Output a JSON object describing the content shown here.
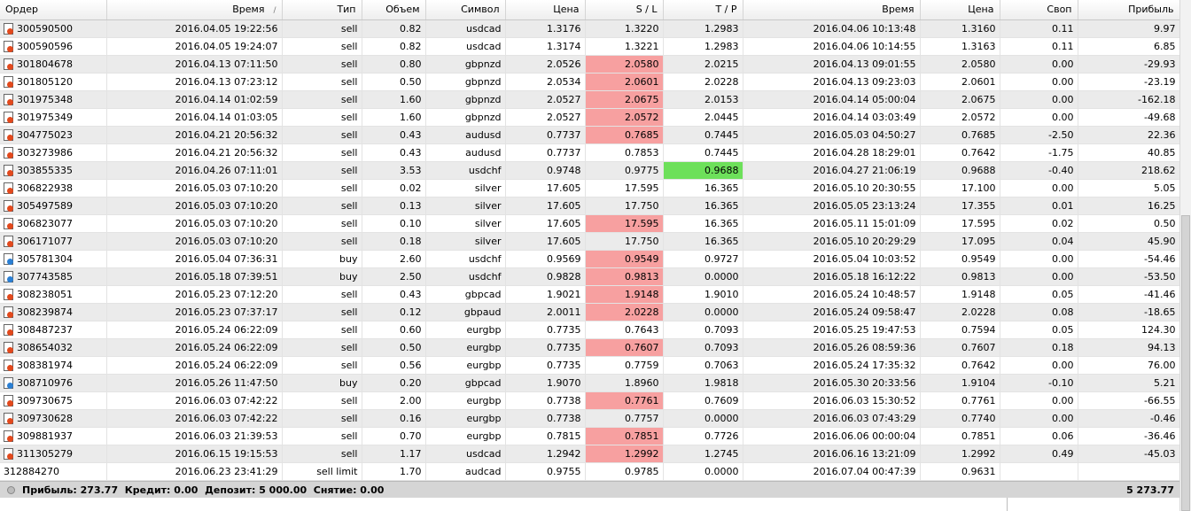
{
  "columns": {
    "order": "Ордер",
    "open_time": "Время",
    "type": "Тип",
    "volume": "Объем",
    "symbol": "Символ",
    "open_price": "Цена",
    "sl": "S / L",
    "tp": "T / P",
    "close_time": "Время",
    "close_price": "Цена",
    "swap": "Своп",
    "profit": "Прибыль"
  },
  "sort_indicator": "/",
  "colors": {
    "sl_hit": "#f7a0a0",
    "tp_hit": "#6de05a",
    "sell_icon": "#e2491d",
    "buy_icon": "#2b7fd3"
  },
  "icons": {
    "sell": "sell-order-icon",
    "buy": "buy-order-icon"
  },
  "rows": [
    {
      "order": "300590500",
      "open_time": "2016.04.05 19:22:56",
      "type": "sell",
      "volume": "0.82",
      "symbol": "usdcad",
      "open_price": "1.3176",
      "sl": "1.3220",
      "tp": "1.2983",
      "close_time": "2016.04.06 10:13:48",
      "close_price": "1.3160",
      "swap": "0.11",
      "profit": "9.97",
      "icon": "sell",
      "hit": ""
    },
    {
      "order": "300590596",
      "open_time": "2016.04.05 19:24:07",
      "type": "sell",
      "volume": "0.82",
      "symbol": "usdcad",
      "open_price": "1.3174",
      "sl": "1.3221",
      "tp": "1.2983",
      "close_time": "2016.04.06 10:14:55",
      "close_price": "1.3163",
      "swap": "0.11",
      "profit": "6.85",
      "icon": "sell",
      "hit": ""
    },
    {
      "order": "301804678",
      "open_time": "2016.04.13 07:11:50",
      "type": "sell",
      "volume": "0.80",
      "symbol": "gbpnzd",
      "open_price": "2.0526",
      "sl": "2.0580",
      "tp": "2.0215",
      "close_time": "2016.04.13 09:01:55",
      "close_price": "2.0580",
      "swap": "0.00",
      "profit": "-29.93",
      "icon": "sell",
      "hit": "sl"
    },
    {
      "order": "301805120",
      "open_time": "2016.04.13 07:23:12",
      "type": "sell",
      "volume": "0.50",
      "symbol": "gbpnzd",
      "open_price": "2.0534",
      "sl": "2.0601",
      "tp": "2.0228",
      "close_time": "2016.04.13 09:23:03",
      "close_price": "2.0601",
      "swap": "0.00",
      "profit": "-23.19",
      "icon": "sell",
      "hit": "sl"
    },
    {
      "order": "301975348",
      "open_time": "2016.04.14 01:02:59",
      "type": "sell",
      "volume": "1.60",
      "symbol": "gbpnzd",
      "open_price": "2.0527",
      "sl": "2.0675",
      "tp": "2.0153",
      "close_time": "2016.04.14 05:00:04",
      "close_price": "2.0675",
      "swap": "0.00",
      "profit": "-162.18",
      "icon": "sell",
      "hit": "sl"
    },
    {
      "order": "301975349",
      "open_time": "2016.04.14 01:03:05",
      "type": "sell",
      "volume": "1.60",
      "symbol": "gbpnzd",
      "open_price": "2.0527",
      "sl": "2.0572",
      "tp": "2.0445",
      "close_time": "2016.04.14 03:03:49",
      "close_price": "2.0572",
      "swap": "0.00",
      "profit": "-49.68",
      "icon": "sell",
      "hit": "sl"
    },
    {
      "order": "304775023",
      "open_time": "2016.04.21 20:56:32",
      "type": "sell",
      "volume": "0.43",
      "symbol": "audusd",
      "open_price": "0.7737",
      "sl": "0.7685",
      "tp": "0.7445",
      "close_time": "2016.05.03 04:50:27",
      "close_price": "0.7685",
      "swap": "-2.50",
      "profit": "22.36",
      "icon": "sell",
      "hit": "sl"
    },
    {
      "order": "303273986",
      "open_time": "2016.04.21 20:56:32",
      "type": "sell",
      "volume": "0.43",
      "symbol": "audusd",
      "open_price": "0.7737",
      "sl": "0.7853",
      "tp": "0.7445",
      "close_time": "2016.04.28 18:29:01",
      "close_price": "0.7642",
      "swap": "-1.75",
      "profit": "40.85",
      "icon": "sell",
      "hit": ""
    },
    {
      "order": "303855335",
      "open_time": "2016.04.26 07:11:01",
      "type": "sell",
      "volume": "3.53",
      "symbol": "usdchf",
      "open_price": "0.9748",
      "sl": "0.9775",
      "tp": "0.9688",
      "close_time": "2016.04.27 21:06:19",
      "close_price": "0.9688",
      "swap": "-0.40",
      "profit": "218.62",
      "icon": "sell",
      "hit": "tp"
    },
    {
      "order": "306822938",
      "open_time": "2016.05.03 07:10:20",
      "type": "sell",
      "volume": "0.02",
      "symbol": "silver",
      "open_price": "17.605",
      "sl": "17.595",
      "tp": "16.365",
      "close_time": "2016.05.10 20:30:55",
      "close_price": "17.100",
      "swap": "0.00",
      "profit": "5.05",
      "icon": "sell",
      "hit": ""
    },
    {
      "order": "305497589",
      "open_time": "2016.05.03 07:10:20",
      "type": "sell",
      "volume": "0.13",
      "symbol": "silver",
      "open_price": "17.605",
      "sl": "17.750",
      "tp": "16.365",
      "close_time": "2016.05.05 23:13:24",
      "close_price": "17.355",
      "swap": "0.01",
      "profit": "16.25",
      "icon": "sell",
      "hit": ""
    },
    {
      "order": "306823077",
      "open_time": "2016.05.03 07:10:20",
      "type": "sell",
      "volume": "0.10",
      "symbol": "silver",
      "open_price": "17.605",
      "sl": "17.595",
      "tp": "16.365",
      "close_time": "2016.05.11 15:01:09",
      "close_price": "17.595",
      "swap": "0.02",
      "profit": "0.50",
      "icon": "sell",
      "hit": "sl"
    },
    {
      "order": "306171077",
      "open_time": "2016.05.03 07:10:20",
      "type": "sell",
      "volume": "0.18",
      "symbol": "silver",
      "open_price": "17.605",
      "sl": "17.750",
      "tp": "16.365",
      "close_time": "2016.05.10 20:29:29",
      "close_price": "17.095",
      "swap": "0.04",
      "profit": "45.90",
      "icon": "sell",
      "hit": ""
    },
    {
      "order": "305781304",
      "open_time": "2016.05.04 07:36:31",
      "type": "buy",
      "volume": "2.60",
      "symbol": "usdchf",
      "open_price": "0.9569",
      "sl": "0.9549",
      "tp": "0.9727",
      "close_time": "2016.05.04 10:03:52",
      "close_price": "0.9549",
      "swap": "0.00",
      "profit": "-54.46",
      "icon": "buy",
      "hit": "sl"
    },
    {
      "order": "307743585",
      "open_time": "2016.05.18 07:39:51",
      "type": "buy",
      "volume": "2.50",
      "symbol": "usdchf",
      "open_price": "0.9828",
      "sl": "0.9813",
      "tp": "0.0000",
      "close_time": "2016.05.18 16:12:22",
      "close_price": "0.9813",
      "swap": "0.00",
      "profit": "-53.50",
      "icon": "buy",
      "hit": "sl"
    },
    {
      "order": "308238051",
      "open_time": "2016.05.23 07:12:20",
      "type": "sell",
      "volume": "0.43",
      "symbol": "gbpcad",
      "open_price": "1.9021",
      "sl": "1.9148",
      "tp": "1.9010",
      "close_time": "2016.05.24 10:48:57",
      "close_price": "1.9148",
      "swap": "0.05",
      "profit": "-41.46",
      "icon": "sell",
      "hit": "sl"
    },
    {
      "order": "308239874",
      "open_time": "2016.05.23 07:37:17",
      "type": "sell",
      "volume": "0.12",
      "symbol": "gbpaud",
      "open_price": "2.0011",
      "sl": "2.0228",
      "tp": "0.0000",
      "close_time": "2016.05.24 09:58:47",
      "close_price": "2.0228",
      "swap": "0.08",
      "profit": "-18.65",
      "icon": "sell",
      "hit": "sl"
    },
    {
      "order": "308487237",
      "open_time": "2016.05.24 06:22:09",
      "type": "sell",
      "volume": "0.60",
      "symbol": "eurgbp",
      "open_price": "0.7735",
      "sl": "0.7643",
      "tp": "0.7093",
      "close_time": "2016.05.25 19:47:53",
      "close_price": "0.7594",
      "swap": "0.05",
      "profit": "124.30",
      "icon": "sell",
      "hit": ""
    },
    {
      "order": "308654032",
      "open_time": "2016.05.24 06:22:09",
      "type": "sell",
      "volume": "0.50",
      "symbol": "eurgbp",
      "open_price": "0.7735",
      "sl": "0.7607",
      "tp": "0.7093",
      "close_time": "2016.05.26 08:59:36",
      "close_price": "0.7607",
      "swap": "0.18",
      "profit": "94.13",
      "icon": "sell",
      "hit": "sl"
    },
    {
      "order": "308381974",
      "open_time": "2016.05.24 06:22:09",
      "type": "sell",
      "volume": "0.56",
      "symbol": "eurgbp",
      "open_price": "0.7735",
      "sl": "0.7759",
      "tp": "0.7063",
      "close_time": "2016.05.24 17:35:32",
      "close_price": "0.7642",
      "swap": "0.00",
      "profit": "76.00",
      "icon": "sell",
      "hit": ""
    },
    {
      "order": "308710976",
      "open_time": "2016.05.26 11:47:50",
      "type": "buy",
      "volume": "0.20",
      "symbol": "gbpcad",
      "open_price": "1.9070",
      "sl": "1.8960",
      "tp": "1.9818",
      "close_time": "2016.05.30 20:33:56",
      "close_price": "1.9104",
      "swap": "-0.10",
      "profit": "5.21",
      "icon": "buy",
      "hit": ""
    },
    {
      "order": "309730675",
      "open_time": "2016.06.03 07:42:22",
      "type": "sell",
      "volume": "2.00",
      "symbol": "eurgbp",
      "open_price": "0.7738",
      "sl": "0.7761",
      "tp": "0.7609",
      "close_time": "2016.06.03 15:30:52",
      "close_price": "0.7761",
      "swap": "0.00",
      "profit": "-66.55",
      "icon": "sell",
      "hit": "sl"
    },
    {
      "order": "309730628",
      "open_time": "2016.06.03 07:42:22",
      "type": "sell",
      "volume": "0.16",
      "symbol": "eurgbp",
      "open_price": "0.7738",
      "sl": "0.7757",
      "tp": "0.0000",
      "close_time": "2016.06.03 07:43:29",
      "close_price": "0.7740",
      "swap": "0.00",
      "profit": "-0.46",
      "icon": "sell",
      "hit": ""
    },
    {
      "order": "309881937",
      "open_time": "2016.06.03 21:39:53",
      "type": "sell",
      "volume": "0.70",
      "symbol": "eurgbp",
      "open_price": "0.7815",
      "sl": "0.7851",
      "tp": "0.7726",
      "close_time": "2016.06.06 00:00:04",
      "close_price": "0.7851",
      "swap": "0.06",
      "profit": "-36.46",
      "icon": "sell",
      "hit": "sl"
    },
    {
      "order": "311305279",
      "open_time": "2016.06.15 19:15:53",
      "type": "sell",
      "volume": "1.17",
      "symbol": "usdcad",
      "open_price": "1.2942",
      "sl": "1.2992",
      "tp": "1.2745",
      "close_time": "2016.06.16 13:21:09",
      "close_price": "1.2992",
      "swap": "0.49",
      "profit": "-45.03",
      "icon": "sell",
      "hit": "sl"
    },
    {
      "order": "312884270",
      "open_time": "2016.06.23 23:41:29",
      "type": "sell limit",
      "volume": "1.70",
      "symbol": "audcad",
      "open_price": "0.9755",
      "sl": "0.9785",
      "tp": "0.0000",
      "close_time": "2016.07.04 00:47:39",
      "close_price": "0.9631",
      "swap": "",
      "profit": "",
      "icon": "",
      "hit": ""
    }
  ],
  "summary": {
    "text": "Прибыль: 273.77  Кредит: 0.00  Депозит: 5 000.00  Снятие: 0.00",
    "total": "5 273.77"
  }
}
